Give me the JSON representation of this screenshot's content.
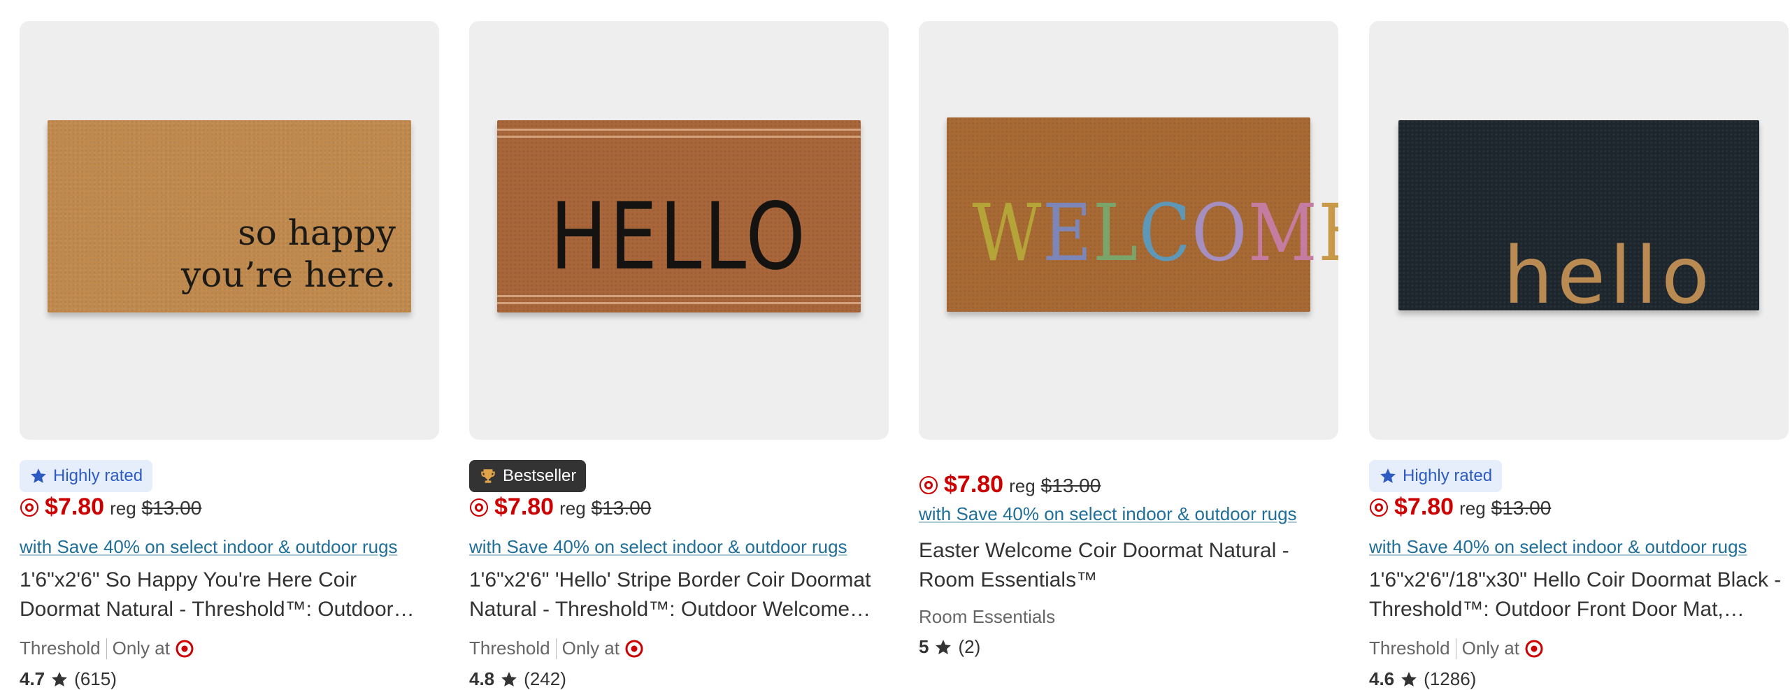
{
  "colors": {
    "price_red": "#cc0000",
    "promo_blue": "#1f6f9a",
    "rated_bg": "#e6eefb",
    "bestseller_bg": "#333333"
  },
  "products": [
    {
      "badge": "Highly rated",
      "badge_icon": "star-icon",
      "mat_text_line1": "so happy",
      "mat_text_line2": "you’re here.",
      "price": "$7.80",
      "reg_label": "reg",
      "reg_price": "$13.00",
      "promo": "with Save 40% on select indoor & outdoor rugs",
      "title": "1'6\"x2'6\" So Happy You're Here Coir Doormat Natural - Threshold™: Outdoor…",
      "brand": "Threshold",
      "only_at": "Only at",
      "rating": "4.7",
      "reviews": "(615)"
    },
    {
      "badge": "Bestseller",
      "badge_icon": "trophy-icon",
      "mat_text": "HELLO",
      "price": "$7.80",
      "reg_label": "reg",
      "reg_price": "$13.00",
      "promo": "with Save 40% on select indoor & outdoor rugs",
      "title": "1'6\"x2'6\" 'Hello' Stripe Border Coir Doormat Natural - Threshold™: Outdoor Welcome…",
      "brand": "Threshold",
      "only_at": "Only at",
      "rating": "4.8",
      "reviews": "(242)"
    },
    {
      "mat_letters": [
        "W",
        "E",
        "L",
        "C",
        "O",
        "M",
        "E"
      ],
      "price": "$7.80",
      "reg_label": "reg",
      "reg_price": "$13.00",
      "promo": "with Save 40% on select indoor & outdoor rugs",
      "title": "Easter Welcome Coir Doormat Natural - Room Essentials™",
      "brand": "Room Essentials",
      "rating": "5",
      "reviews": "(2)"
    },
    {
      "badge": "Highly rated",
      "badge_icon": "star-icon",
      "mat_text": "hello",
      "price": "$7.80",
      "reg_label": "reg",
      "reg_price": "$13.00",
      "promo": "with Save 40% on select indoor & outdoor rugs",
      "title": "1'6\"x2'6\"/18\"x30\" Hello Coir Doormat Black - Threshold™: Outdoor Front Door Mat,…",
      "brand": "Threshold",
      "only_at": "Only at",
      "rating": "4.6",
      "reviews": "(1286)"
    }
  ]
}
